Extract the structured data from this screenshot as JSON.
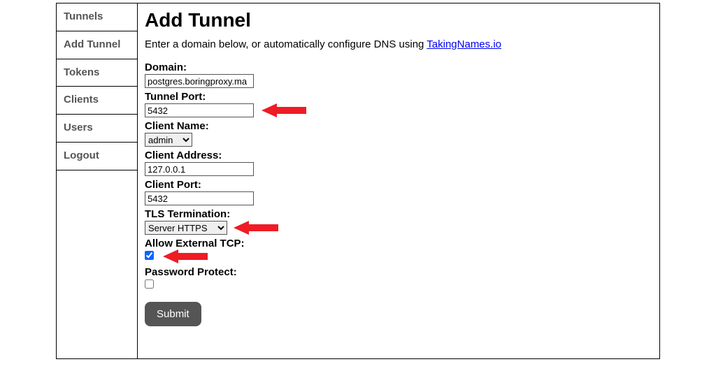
{
  "sidebar": {
    "items": [
      {
        "label": "Tunnels"
      },
      {
        "label": "Add Tunnel"
      },
      {
        "label": "Tokens"
      },
      {
        "label": "Clients"
      },
      {
        "label": "Users"
      },
      {
        "label": "Logout"
      }
    ]
  },
  "page": {
    "title": "Add Tunnel",
    "intro_prefix": "Enter a domain below, or automatically configure DNS using ",
    "intro_link_text": "TakingNames.io"
  },
  "form": {
    "domain": {
      "label": "Domain:",
      "value": "postgres.boringproxy.ma"
    },
    "tunnel_port": {
      "label": "Tunnel Port:",
      "value": "5432"
    },
    "client_name": {
      "label": "Client Name:",
      "selected": "admin"
    },
    "client_address": {
      "label": "Client Address:",
      "value": "127.0.0.1"
    },
    "client_port": {
      "label": "Client Port:",
      "value": "5432"
    },
    "tls_termination": {
      "label": "TLS Termination:",
      "selected": "Server HTTPS"
    },
    "allow_external": {
      "label": "Allow External TCP:",
      "checked": true
    },
    "password_protect": {
      "label": "Password Protect:",
      "checked": false
    },
    "submit_label": "Submit"
  }
}
